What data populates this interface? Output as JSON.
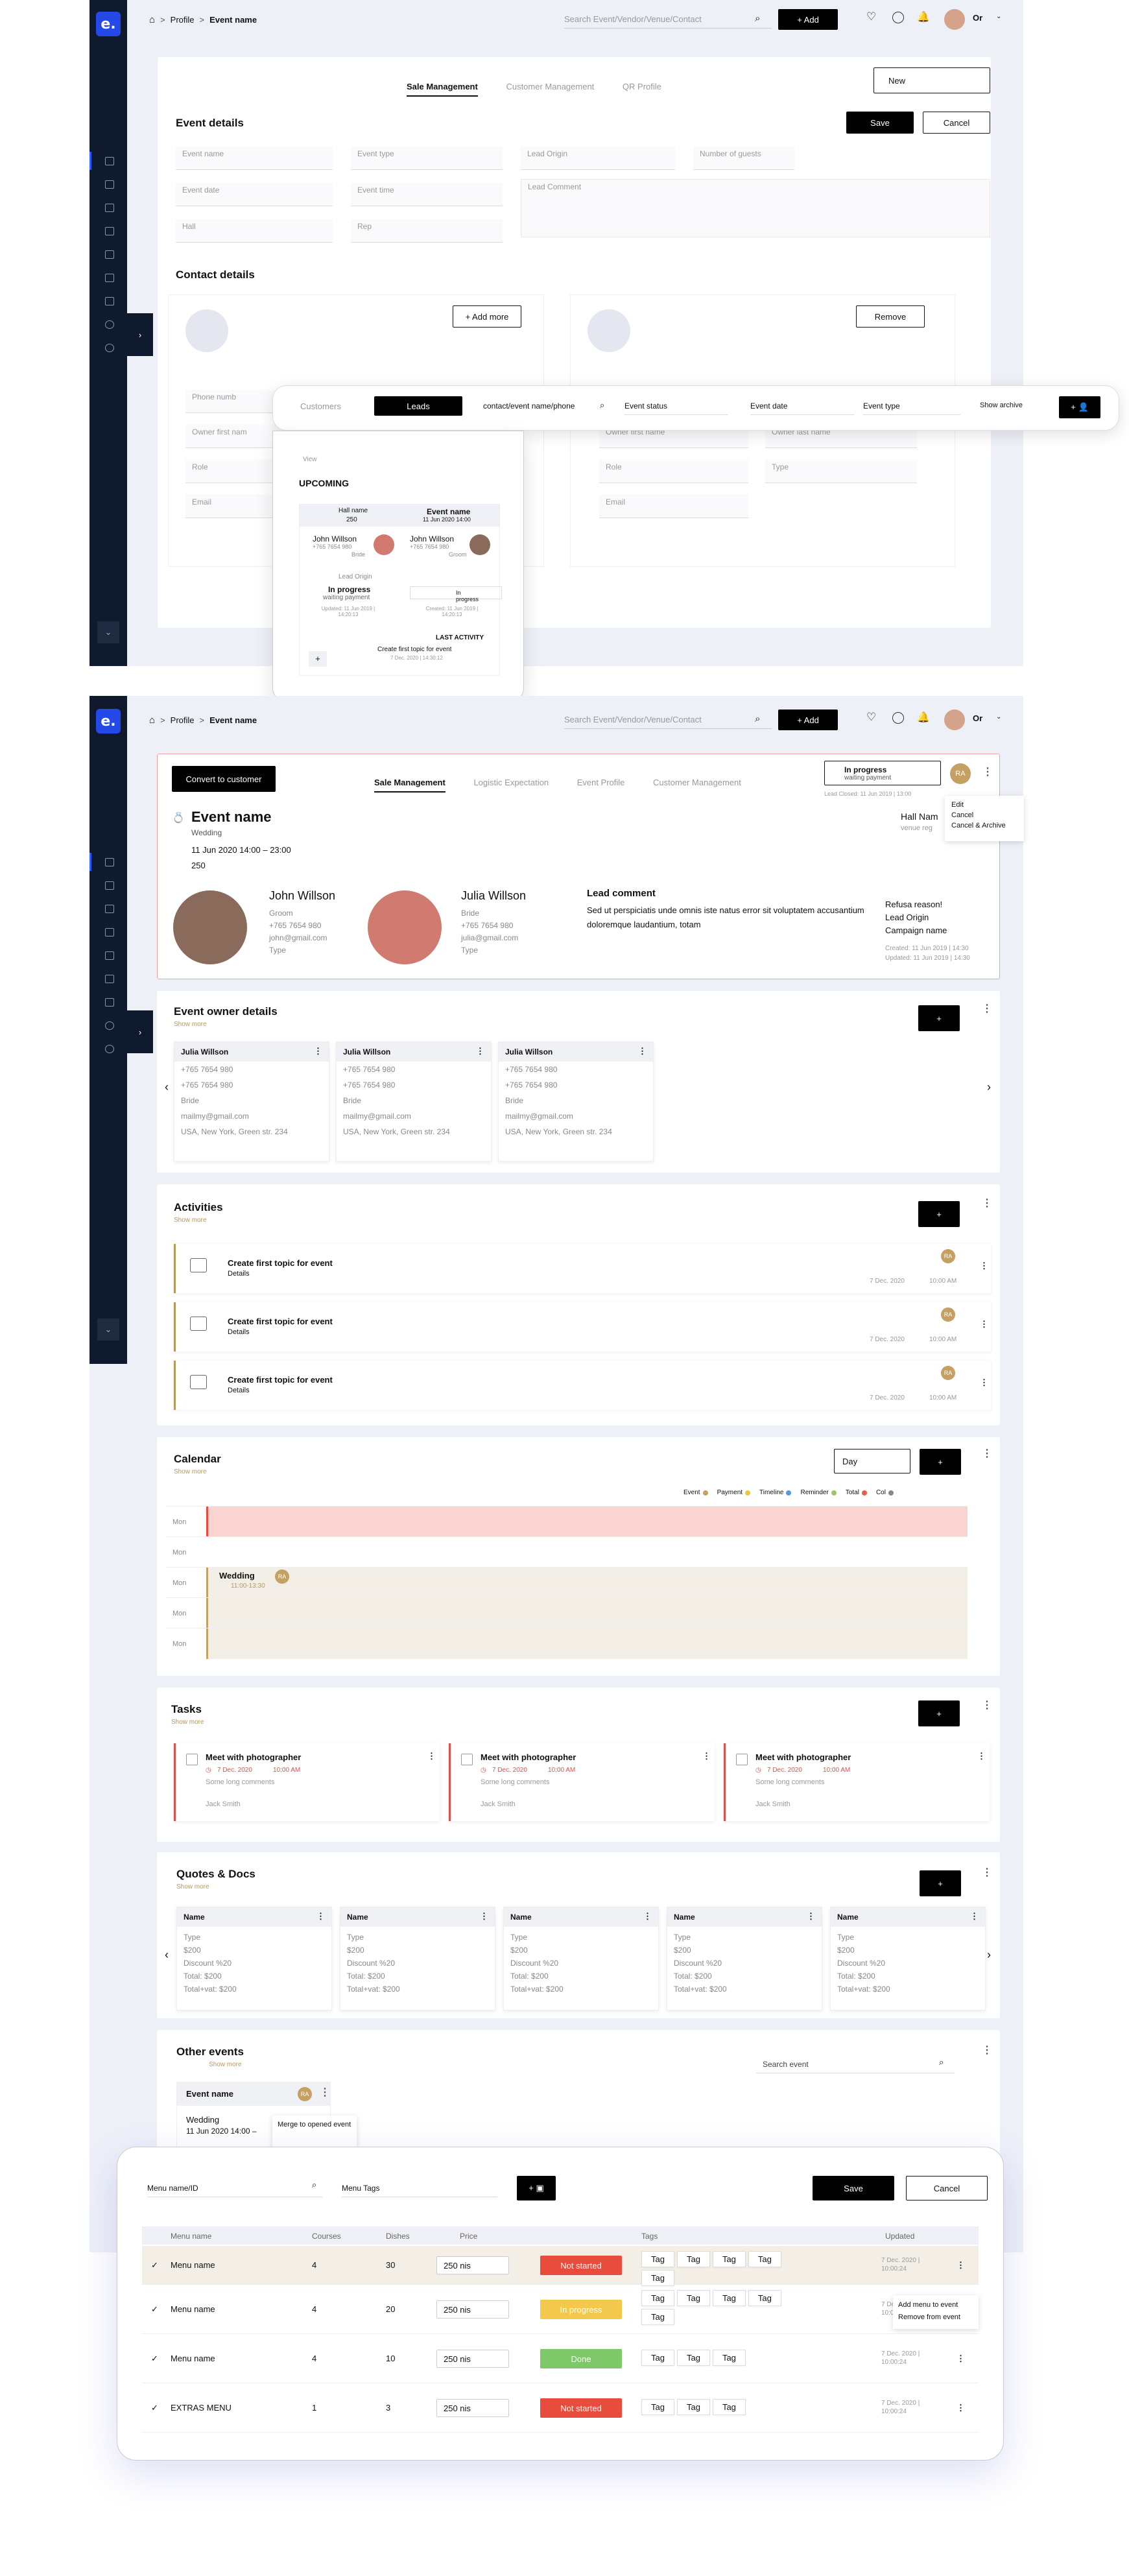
{
  "brand": {
    "logo": "e.",
    "avatar_initials": "Or"
  },
  "crumbs": {
    "profile": "Profile",
    "event": "Event name",
    "sep": ">"
  },
  "search": {
    "placeholder": "Search Event/Vendor/Venue/Contact",
    "add": "+ Add"
  },
  "screen1": {
    "tabs": [
      "Sale Management",
      "Customer Management",
      "QR Profile"
    ],
    "status_value": "New",
    "save": "Save",
    "cancel": "Cancel",
    "event_details": "Event details",
    "fields": {
      "event_name": "Event name",
      "event_type": "Event type",
      "lead_origin": "Lead Origin",
      "guests": "Number of guests",
      "event_date": "Event date",
      "event_time": "Event time",
      "lead_comment": "Lead Comment",
      "hall": "Hall",
      "rep": "Rep"
    },
    "contact_details": "Contact details",
    "add_more": "+ Add more",
    "remove": "Remove",
    "contact_fields": {
      "phone": "Phone numb",
      "owner_first": "Owner first nam",
      "owner_first2": "Owner first name",
      "owner_last": "Owner last name",
      "role": "Role",
      "type": "Type",
      "email": "Email"
    }
  },
  "leads": {
    "toggle": [
      "Customers",
      "Leads"
    ],
    "search": "contact/event name/phone",
    "event_status": "Event status",
    "event_date": "Event date",
    "event_type": "Event type",
    "show_archive": "Show archive",
    "view": "View",
    "upcoming": "UPCOMING",
    "hall_name": "Hall name",
    "hall_count": "250",
    "ev_name": "Event name",
    "ev_date": "11 Jun 2020 14:00",
    "p1": {
      "name": "John Willson",
      "phone": "+765 7654 980",
      "role": "Bride"
    },
    "p2": {
      "name": "John Willson",
      "phone": "+765 7654 980",
      "role": "Groom"
    },
    "lead_origin": "Lead Origin",
    "in_progress": "In progress",
    "waiting": "waiting payment",
    "in_progress_small": "In progress",
    "updated": "Updated: 11 Jun 2019 | 14:20:13",
    "created": "Created: 11 Jun 2019 | 14:20:13",
    "last_activity": "LAST ACTIVITY",
    "activity": "Create first topic for event",
    "activity_date": "7 Dec. 2020 | 14:30:12",
    "plus": "+"
  },
  "screen2": {
    "convert": "Convert to customer",
    "tabs": [
      "Sale Management",
      "Logistic Expectation",
      "Event Profile",
      "Customer Management"
    ],
    "status": "In progress",
    "status_sub": "waiting payment",
    "ra": "RA",
    "lead_closed": "Lead Closed: 11 Jun 2019 | 13:00",
    "menu": [
      "Edit",
      "Cancel",
      "Cancel & Archive"
    ],
    "event_name": "Event name",
    "event_type": "Wedding",
    "event_time": "11 Jun 2020 14:00 – 23:00",
    "guests": "250",
    "hall": "Hall Nam",
    "venue": "venue reg",
    "groom": {
      "name": "John Willson",
      "role": "Groom",
      "phone": "+765 7654 980",
      "mail": "john@gmail.com",
      "type": "Type"
    },
    "bride": {
      "name": "Julia Willson",
      "role": "Bride",
      "phone": "+765 7654 980",
      "mail": "julia@gmail.com",
      "type": "Type"
    },
    "lead_comment": "Lead comment",
    "comment_text": "Sed ut perspiciatis unde omnis iste natus error sit voluptatem accusantium doloremque laudantium, totam",
    "refusal": "Refusa reason!",
    "lead_origin": "Lead Origin",
    "campaign": "Campaign name",
    "created": "Created: 11 Jun 2019 | 14:30",
    "updated": "Updated: 11 Jun 2019 | 14:30"
  },
  "owners": {
    "title": "Event owner details",
    "show_more": "Show more",
    "plus": "+",
    "cards": [
      {
        "name": "Julia Willson",
        "p1": "+765 7654 980",
        "p2": "+765 7654 980",
        "role": "Bride",
        "mail": "mailmy@gmail.com",
        "addr": "USA, New York, Green str. 234"
      },
      {
        "name": "Julia Willson",
        "p1": "+765 7654 980",
        "p2": "+765 7654 980",
        "role": "Bride",
        "mail": "mailmy@gmail.com",
        "addr": "USA, New York, Green str. 234"
      },
      {
        "name": "Julia Willson",
        "p1": "+765 7654 980",
        "p2": "+765 7654 980",
        "role": "Bride",
        "mail": "mailmy@gmail.com",
        "addr": "USA, New York, Green str. 234"
      }
    ]
  },
  "activities": {
    "title": "Activities",
    "show_more": "Show more",
    "plus": "+",
    "rows": [
      {
        "title": "Create first topic for event",
        "sub": "Details",
        "date": "7 Dec. 2020",
        "time": "10:00 AM",
        "ra": "RA"
      },
      {
        "title": "Create first topic for event",
        "sub": "Details",
        "date": "7 Dec. 2020",
        "time": "10:00 AM",
        "ra": "RA"
      },
      {
        "title": "Create first topic for event",
        "sub": "Details",
        "date": "7 Dec. 2020",
        "time": "10:00 AM",
        "ra": "RA"
      }
    ]
  },
  "calendar": {
    "title": "Calendar",
    "show_more": "Show more",
    "view": "Day",
    "plus": "+",
    "legend": [
      {
        "name": "Event",
        "color": "#c5a063"
      },
      {
        "name": "Payment",
        "color": "#e8c840"
      },
      {
        "name": "Timeline",
        "color": "#5a9ae0"
      },
      {
        "name": "Reminder",
        "color": "#9ec46a"
      },
      {
        "name": "Total",
        "color": "#e0604a"
      },
      {
        "name": "Col",
        "color": "#888888"
      }
    ],
    "days": [
      "Mon",
      "Mon",
      "Mon",
      "Mon",
      "Mon"
    ],
    "event": "Wedding",
    "event_time": "11:00-13:30",
    "ra": "RA"
  },
  "tasks": {
    "title": "Tasks",
    "show_more": "Show more",
    "plus": "+",
    "items": [
      {
        "title": "Meet with photographer",
        "date": "7 Dec. 2020",
        "time": "10:00 AM",
        "sub": "Some long comments",
        "who": "Jack Smith"
      },
      {
        "title": "Meet with photographer",
        "date": "7 Dec. 2020",
        "time": "10:00 AM",
        "sub": "Some long comments",
        "who": "Jack Smith"
      },
      {
        "title": "Meet with photographer",
        "date": "7 Dec. 2020",
        "time": "10:00 AM",
        "sub": "Some long comments",
        "who": "Jack Smith"
      }
    ]
  },
  "quotes": {
    "title": "Quotes & Docs",
    "show_more": "Show more",
    "plus": "+",
    "cards": [
      {
        "name": "Name",
        "type": "Type",
        "price": "$200",
        "disc": "Discount %20",
        "total": "Total: $200",
        "vat": "Total+vat: $200"
      },
      {
        "name": "Name",
        "type": "Type",
        "price": "$200",
        "disc": "Discount %20",
        "total": "Total: $200",
        "vat": "Total+vat: $200"
      },
      {
        "name": "Name",
        "type": "Type",
        "price": "$200",
        "disc": "Discount %20",
        "total": "Total: $200",
        "vat": "Total+vat: $200"
      },
      {
        "name": "Name",
        "type": "Type",
        "price": "$200",
        "disc": "Discount %20",
        "total": "Total: $200",
        "vat": "Total+vat: $200"
      },
      {
        "name": "Name",
        "type": "Type",
        "price": "$200",
        "disc": "Discount %20",
        "total": "Total: $200",
        "vat": "Total+vat: $200"
      }
    ]
  },
  "other": {
    "title": "Other events",
    "show_more": "Show more",
    "search": "Search event",
    "ev": "Event name",
    "ra": "RA",
    "type": "Wedding",
    "date": "11 Jun 2020 14:00 –",
    "merge": "Merge to opened event"
  },
  "menus": {
    "search": "Menu name/ID",
    "tags": "Menu Tags",
    "save": "Save",
    "cancel": "Cancel",
    "headers": [
      "Menu name",
      "Courses",
      "Dishes",
      "Price",
      "Tags",
      "Updated"
    ],
    "rows": [
      {
        "name": "Menu name",
        "courses": "4",
        "dishes": "30",
        "price": "250 nis",
        "status": "Not started",
        "color": "#e74c3c",
        "tags": [
          "Tag",
          "Tag",
          "Tag",
          "Tag",
          "Tag"
        ],
        "upd": "7 Dec. 2020 | 10:00:24"
      },
      {
        "name": "Menu name",
        "courses": "4",
        "dishes": "20",
        "price": "250 nis",
        "status": "In progress",
        "color": "#f2c94c",
        "tags": [
          "Tag",
          "Tag",
          "Tag",
          "Tag",
          "Tag"
        ],
        "upd": "7 Dec. 2020 | 10:00:24"
      },
      {
        "name": "Menu name",
        "courses": "4",
        "dishes": "10",
        "price": "250 nis",
        "status": "Done",
        "color": "#7ec86a",
        "tags": [
          "Tag",
          "Tag",
          "Tag"
        ],
        "upd": "7 Dec. 2020 | 10:00:24"
      },
      {
        "name": "EXTRAS MENU",
        "courses": "1",
        "dishes": "3",
        "price": "250 nis",
        "status": "Not started",
        "color": "#e74c3c",
        "tags": [
          "Tag",
          "Tag",
          "Tag"
        ],
        "upd": "7 Dec. 2020 | 10:00:24"
      }
    ],
    "ctx": [
      "Add menu to event",
      "Remove from event"
    ]
  }
}
